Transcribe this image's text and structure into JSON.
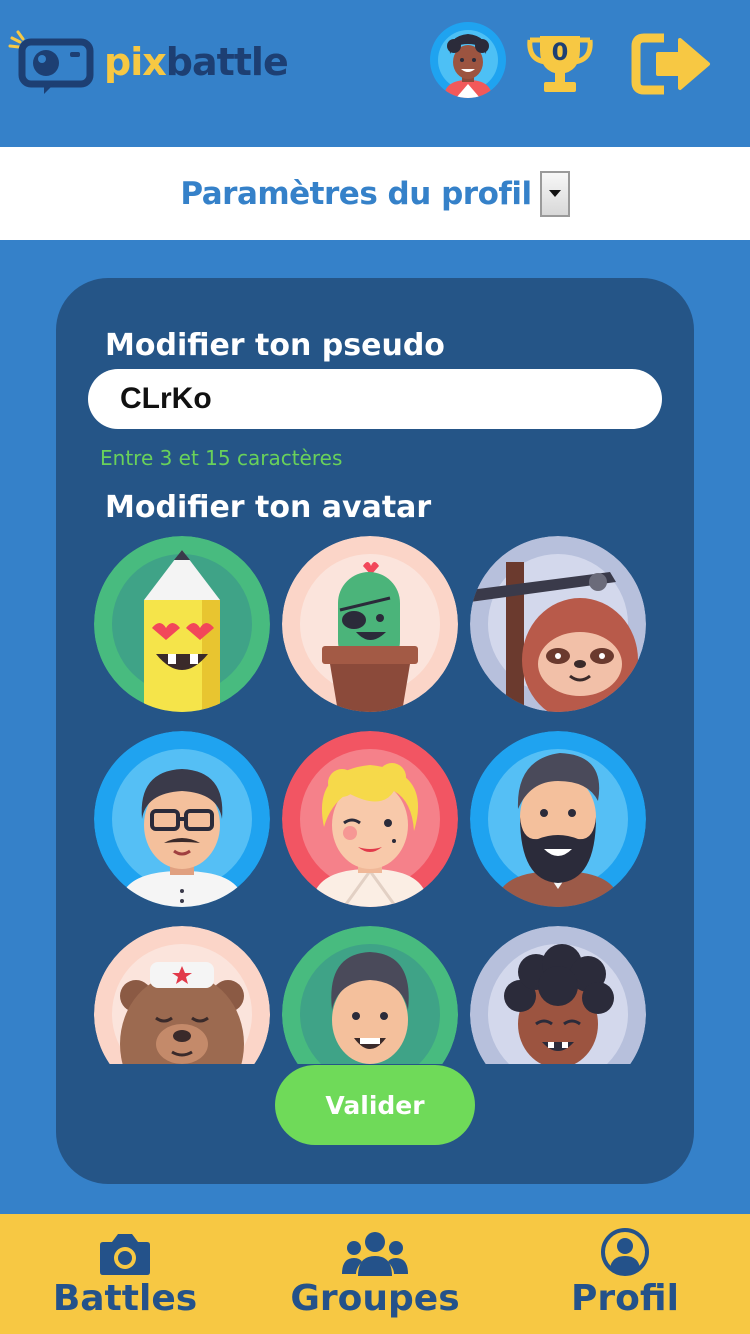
{
  "app": {
    "logo_pix": "pix",
    "logo_battle": "battle",
    "trophy_count": "0"
  },
  "title": {
    "text": "Paramètres du profil"
  },
  "form": {
    "pseudo_label": "Modifier ton pseudo",
    "pseudo_value": "CLrKo",
    "pseudo_hint": "Entre 3 et 15 caractères",
    "avatar_label": "Modifier ton avatar",
    "avatars": [
      "pencil-avatar",
      "cactus-avatar",
      "sloth-avatar",
      "glasses-man-avatar",
      "blonde-woman-avatar",
      "bearded-man-avatar",
      "bear-avatar",
      "smiling-man-avatar",
      "curly-hair-avatar"
    ],
    "submit_label": "Valider"
  },
  "nav": {
    "battles": "Battles",
    "groups": "Groupes",
    "profile": "Profil"
  },
  "colors": {
    "brand_blue": "#3581c9",
    "card_blue": "#255587",
    "brand_yellow": "#f7c843",
    "accent_green": "#6fda59"
  }
}
